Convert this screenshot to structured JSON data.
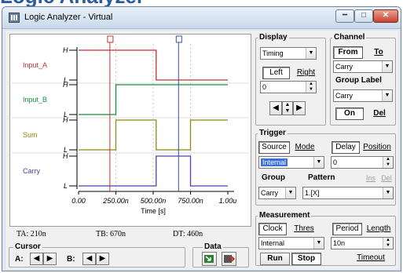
{
  "window": {
    "title": "Logic Analyzer - Virtual",
    "buttons": [
      "minimize-icon",
      "maximize-icon",
      "close-icon"
    ]
  },
  "chart_data": {
    "type": "line",
    "xlabel": "Time [s]",
    "x_tick_labels": [
      "0.00",
      "250.00n",
      "500.00n",
      "750.00n",
      "1.00u"
    ],
    "xlim": [
      0,
      1e-06
    ],
    "level_labels": [
      "H",
      "L"
    ],
    "cursors": [
      {
        "name": "A",
        "x": 2.1e-07,
        "color": "#d03030"
      },
      {
        "name": "B",
        "x": 6.7e-07,
        "color": "#3050a0"
      }
    ],
    "series": [
      {
        "name": "Input_A",
        "color": "#c03030",
        "x": [
          0,
          5.2e-07,
          5.2e-07,
          1e-06
        ],
        "y": [
          1,
          1,
          0,
          0
        ]
      },
      {
        "name": "Input_B",
        "color": "#109040",
        "x": [
          0,
          2.5e-07,
          2.5e-07,
          1e-06
        ],
        "y": [
          0,
          0,
          1,
          1
        ]
      },
      {
        "name": "Sum",
        "color": "#8a8a10",
        "x": [
          0,
          2.5e-07,
          2.5e-07,
          5.2e-07,
          5.2e-07,
          7.5e-07,
          7.5e-07,
          1e-06
        ],
        "y": [
          0,
          0,
          1,
          1,
          0,
          0,
          1,
          1
        ]
      },
      {
        "name": "Carry",
        "color": "#5a3ab0",
        "x": [
          0,
          5.2e-07,
          5.2e-07,
          7.5e-07,
          7.5e-07,
          1e-06
        ],
        "y": [
          0,
          0,
          1,
          1,
          0,
          0
        ]
      }
    ]
  },
  "readouts": {
    "ta": "TA: 210n",
    "tb": "TB: 670n",
    "dt": "DT: 460n"
  },
  "cursor": {
    "title": "Cursor",
    "a_label": "A:",
    "b_label": "B:"
  },
  "data": {
    "title": "Data"
  },
  "display": {
    "title": "Display",
    "mode": "Timing",
    "left": "Left",
    "right": "Right",
    "value": "0"
  },
  "channel": {
    "title": "Channel",
    "from": "From",
    "to": "To",
    "channel_value": "Carry",
    "group_label_title": "Group Label",
    "group_label_value": "Carry",
    "on": "On",
    "del": "Del"
  },
  "trigger": {
    "title": "Trigger",
    "source": "Source",
    "mode": "Mode",
    "delay": "Delay",
    "position": "Position",
    "source_value": "Internal",
    "delay_value": "0",
    "group_label": "Group",
    "pattern_label": "Pattern",
    "ins": "Ins",
    "del": "Del",
    "group_value": "Carry",
    "pattern_value": "1.[X]"
  },
  "measurement": {
    "title": "Measurement",
    "clock": "Clock",
    "thres": "Thres",
    "period": "Period",
    "length": "Length",
    "clock_value": "Internal",
    "period_value": "10n",
    "run": "Run",
    "stop": "Stop",
    "timeout": "Timeout"
  },
  "background_text": "Logic Analyzer"
}
